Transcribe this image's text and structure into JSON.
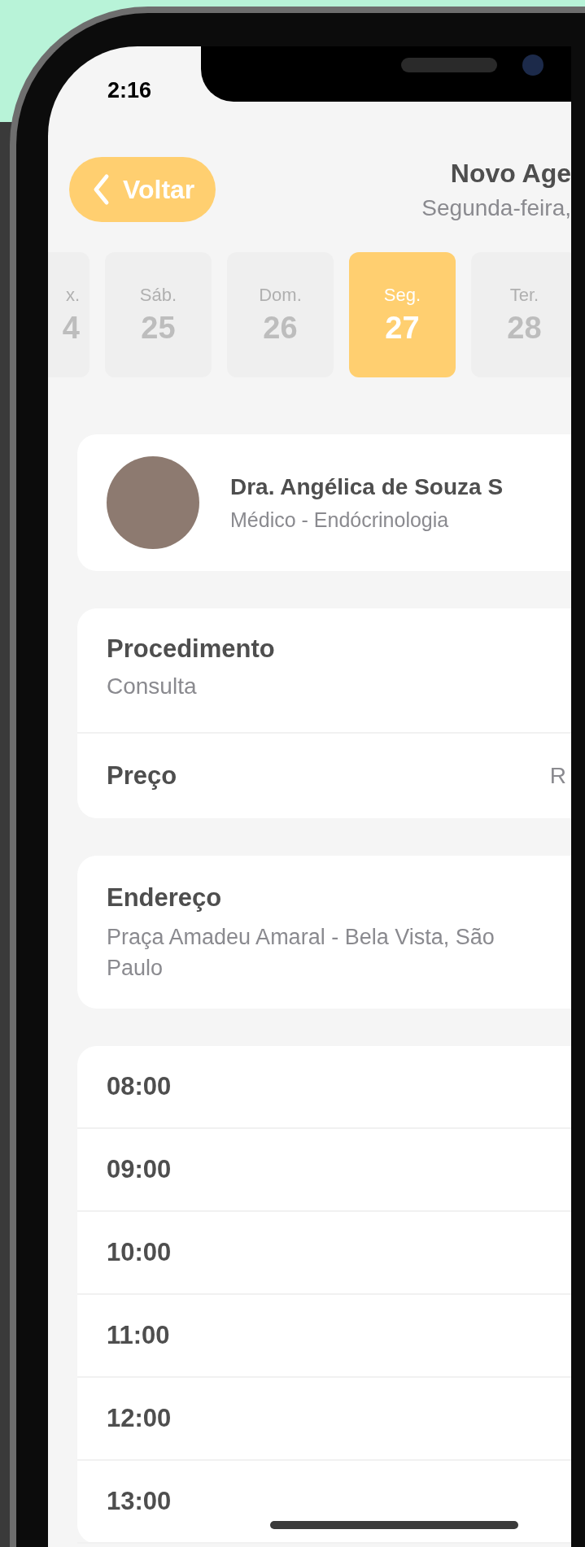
{
  "status_bar": {
    "time": "2:16"
  },
  "header": {
    "back_button": "Voltar",
    "title": "Novo Age",
    "subtitle": "Segunda-feira,"
  },
  "days": [
    {
      "weekday": "x.",
      "day": "4",
      "selected": false
    },
    {
      "weekday": "Sáb.",
      "day": "25",
      "selected": false
    },
    {
      "weekday": "Dom.",
      "day": "26",
      "selected": false
    },
    {
      "weekday": "Seg.",
      "day": "27",
      "selected": true
    },
    {
      "weekday": "Ter.",
      "day": "28",
      "selected": false
    }
  ],
  "doctor": {
    "name": "Dra. Angélica de Souza S",
    "specialty": "Médico - Endócrinologia"
  },
  "procedure": {
    "label": "Procedimento",
    "value": "Consulta"
  },
  "price": {
    "label": "Preço",
    "value": "R"
  },
  "address": {
    "label": "Endereço",
    "value": "Praça Amadeu Amaral - Bela Vista, São Paulo"
  },
  "times": [
    "08:00",
    "09:00",
    "10:00",
    "11:00",
    "12:00",
    "13:00"
  ]
}
